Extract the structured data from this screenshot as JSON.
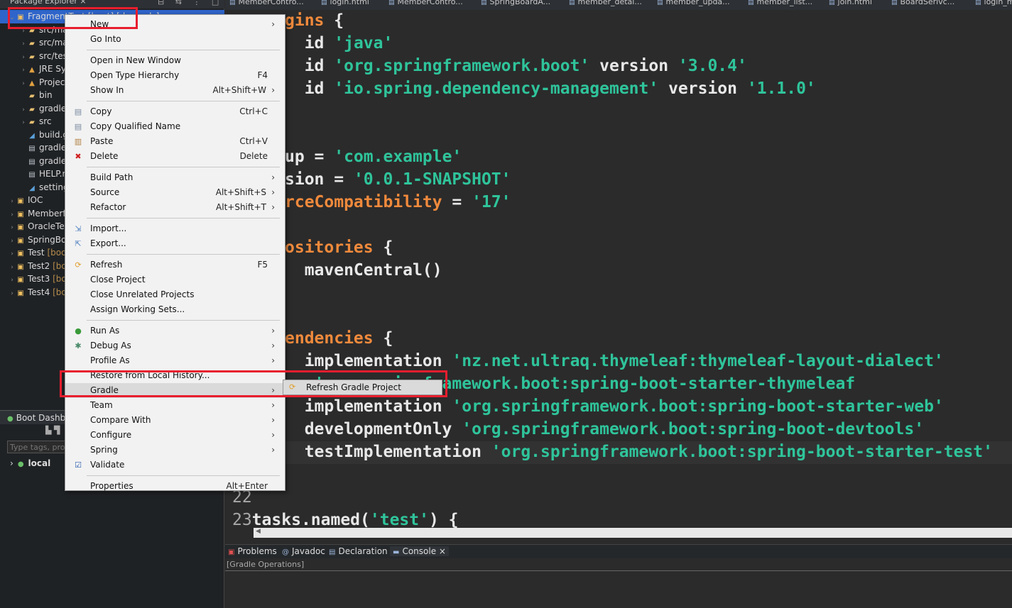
{
  "package_explorer": {
    "title": "Package Explorer ×",
    "toolbar": "⊟ ⇆ ⋮ □",
    "items": [
      {
        "twisty": "⌄",
        "icon": "▣",
        "icon_class": "ic-project",
        "label": "FragmentTest [boot] [devtools]",
        "dec": "",
        "indent": 0,
        "selected": true
      },
      {
        "twisty": "›",
        "icon": "▰",
        "icon_class": "ic-folder",
        "label": "src/ma",
        "dec": "",
        "indent": 1
      },
      {
        "twisty": "›",
        "icon": "▰",
        "icon_class": "ic-folder",
        "label": "src/ma",
        "dec": "",
        "indent": 1
      },
      {
        "twisty": "›",
        "icon": "▰",
        "icon_class": "ic-folder",
        "label": "src/tes",
        "dec": "",
        "indent": 1
      },
      {
        "twisty": "›",
        "icon": "▲",
        "icon_class": "ic-lib",
        "label": "JRE Sy",
        "dec": "",
        "indent": 1
      },
      {
        "twisty": "›",
        "icon": "▲",
        "icon_class": "ic-lib",
        "label": "Projec",
        "dec": "",
        "indent": 1
      },
      {
        "twisty": "",
        "icon": "▰",
        "icon_class": "ic-folder",
        "label": "bin",
        "dec": "",
        "indent": 1
      },
      {
        "twisty": "›",
        "icon": "▰",
        "icon_class": "ic-folder",
        "label": "gradle",
        "dec": "",
        "indent": 1
      },
      {
        "twisty": "›",
        "icon": "▰",
        "icon_class": "ic-folder",
        "label": "src",
        "dec": "",
        "indent": 1
      },
      {
        "twisty": "",
        "icon": "◢",
        "icon_class": "ic-gear",
        "label": "build.g",
        "dec": "",
        "indent": 1
      },
      {
        "twisty": "",
        "icon": "▤",
        "icon_class": "ic-file",
        "label": "gradle",
        "dec": "",
        "indent": 1
      },
      {
        "twisty": "",
        "icon": "▤",
        "icon_class": "ic-file",
        "label": "gradle",
        "dec": "",
        "indent": 1
      },
      {
        "twisty": "",
        "icon": "▤",
        "icon_class": "ic-file",
        "label": "HELP.r",
        "dec": "",
        "indent": 1
      },
      {
        "twisty": "",
        "icon": "◢",
        "icon_class": "ic-gear",
        "label": "setting",
        "dec": "",
        "indent": 1
      },
      {
        "twisty": "›",
        "icon": "▣",
        "icon_class": "ic-project",
        "label": "IOC",
        "dec": "",
        "indent": 0
      },
      {
        "twisty": "›",
        "icon": "▣",
        "icon_class": "ic-project",
        "label": "Memberf",
        "dec": "",
        "indent": 0
      },
      {
        "twisty": "›",
        "icon": "▣",
        "icon_class": "ic-project",
        "label": "OracleTe",
        "dec": "",
        "indent": 0
      },
      {
        "twisty": "›",
        "icon": "▣",
        "icon_class": "ic-project",
        "label": "SpringBo",
        "dec": "",
        "indent": 0
      },
      {
        "twisty": "›",
        "icon": "▣",
        "icon_class": "ic-project",
        "label": "Test ",
        "dec": "[boo",
        "indent": 0
      },
      {
        "twisty": "›",
        "icon": "▣",
        "icon_class": "ic-project",
        "label": "Test2 ",
        "dec": "[bo",
        "indent": 0
      },
      {
        "twisty": "›",
        "icon": "▣",
        "icon_class": "ic-project",
        "label": "Test3 ",
        "dec": "[bo",
        "indent": 0
      },
      {
        "twisty": "›",
        "icon": "▣",
        "icon_class": "ic-project",
        "label": "Test4 ",
        "dec": "[bo",
        "indent": 0
      }
    ]
  },
  "boot_dashboard": {
    "title": "Boot Dashb",
    "toolbar": "▙ ▜",
    "filter_placeholder": "Type tags, pro",
    "local_label": "local"
  },
  "editor_tabs": [
    {
      "label": "MemberContro..."
    },
    {
      "label": "login.html"
    },
    {
      "label": "MemberContro..."
    },
    {
      "label": "SpringBoardA..."
    },
    {
      "label": "member_detai..."
    },
    {
      "label": "member_upda..."
    },
    {
      "label": "member_list..."
    },
    {
      "label": "join.html"
    },
    {
      "label": "BoardSerivc..."
    },
    {
      "label": "login_m"
    }
  ],
  "code_lines": [
    {
      "num": "",
      "segments": [
        {
          "t": "gins {",
          "c": "kw-key",
          "partial": "gins",
          "rest": " {"
        }
      ]
    },
    {
      "num": "",
      "text_parts": [
        [
          "  id ",
          ""
        ],
        [
          "'java'",
          "kw-str"
        ]
      ]
    },
    {
      "num": "",
      "text_parts": [
        [
          "  id ",
          ""
        ],
        [
          "'org.springframework.boot'",
          "kw-str"
        ],
        [
          " version ",
          ""
        ],
        [
          "'3.0.4'",
          "kw-str"
        ]
      ]
    },
    {
      "num": "",
      "text_parts": [
        [
          "  id ",
          ""
        ],
        [
          "'io.spring.dependency-management'",
          "kw-str"
        ],
        [
          " version ",
          ""
        ],
        [
          "'1.1.0'",
          "kw-str"
        ]
      ]
    },
    {
      "num": "",
      "text_parts": [
        [
          "",
          ""
        ]
      ]
    },
    {
      "num": "",
      "text_parts": [
        [
          "",
          ""
        ]
      ]
    },
    {
      "num": "",
      "text_parts": [
        [
          "up = ",
          ""
        ],
        [
          "'com.example'",
          "kw-str"
        ]
      ]
    },
    {
      "num": "",
      "text_parts": [
        [
          "sion = ",
          ""
        ],
        [
          "'0.0.1-SNAPSHOT'",
          "kw-str"
        ]
      ]
    },
    {
      "num": "",
      "text_parts": [
        [
          "rceCompatibility",
          "kw-key"
        ],
        [
          " = ",
          ""
        ],
        [
          "'17'",
          "kw-str"
        ]
      ]
    },
    {
      "num": "",
      "text_parts": [
        [
          "",
          ""
        ]
      ]
    },
    {
      "num": "",
      "text_parts": [
        [
          "ositories",
          "kw-key"
        ],
        [
          " {",
          ""
        ]
      ]
    },
    {
      "num": "",
      "text_parts": [
        [
          "  mavenCentral()",
          ""
        ]
      ]
    },
    {
      "num": "",
      "text_parts": [
        [
          "",
          ""
        ]
      ]
    },
    {
      "num": "",
      "text_parts": [
        [
          "",
          ""
        ]
      ]
    },
    {
      "num": "",
      "text_parts": [
        [
          "endencies",
          "kw-key"
        ],
        [
          " {",
          ""
        ]
      ]
    },
    {
      "num": "",
      "text_parts": [
        [
          "  implementation ",
          ""
        ],
        [
          "'nz.net.ultraq.thymeleaf:thymeleaf-layout-dialect'",
          "kw-str"
        ]
      ]
    },
    {
      "num": "",
      "text_parts": [
        [
          "on ",
          ""
        ],
        [
          "'org.springframework.boot:spring-boot-starter-thymeleaf",
          "kw-str"
        ]
      ]
    },
    {
      "num": "",
      "text_parts": [
        [
          "  implementation ",
          ""
        ],
        [
          "'org.springframework.boot:spring-boot-starter-web'",
          "kw-str"
        ]
      ]
    },
    {
      "num": "",
      "text_parts": [
        [
          "  developmentOnly ",
          ""
        ],
        [
          "'org.springframework.boot:spring-boot-devtools'",
          "kw-str"
        ]
      ]
    },
    {
      "num": "",
      "text_parts": [
        [
          "  testImplementation ",
          ""
        ],
        [
          "'org.springframework.boot:spring-boot-starter-test'",
          "kw-str"
        ]
      ]
    },
    {
      "num": "",
      "text_parts": [
        [
          "",
          ""
        ]
      ]
    },
    {
      "num": "22",
      "text_parts": [
        [
          "",
          ""
        ]
      ]
    },
    {
      "num": "23",
      "text_parts": [
        [
          "tasks.named(",
          ""
        ],
        [
          "'test'",
          "kw-str"
        ],
        [
          ") {",
          ""
        ]
      ]
    }
  ],
  "bottom_tabs": [
    {
      "label": "Problems",
      "icon": "▣",
      "color": "#e05050"
    },
    {
      "label": "Javadoc",
      "icon": "@",
      "color": "#9bb4d8"
    },
    {
      "label": "Declaration",
      "icon": "▤",
      "color": "#9bb4d8"
    },
    {
      "label": "Console ×",
      "icon": "▬",
      "color": "#9bb4d8"
    }
  ],
  "console_label": "[Gradle Operations]",
  "context_menu": {
    "items": [
      {
        "label": "New",
        "shortcut": "",
        "arrow": true,
        "icon": "",
        "icon_color": ""
      },
      {
        "label": "Go Into",
        "shortcut": "",
        "arrow": false,
        "icon": "",
        "icon_color": ""
      },
      {
        "sep": true
      },
      {
        "label": "Open in New Window",
        "shortcut": "",
        "arrow": false,
        "icon": "",
        "icon_color": ""
      },
      {
        "label": "Open Type Hierarchy",
        "shortcut": "F4",
        "arrow": false,
        "icon": "",
        "icon_color": ""
      },
      {
        "label": "Show In",
        "shortcut": "Alt+Shift+W",
        "arrow": true,
        "icon": "",
        "icon_color": ""
      },
      {
        "sep": true
      },
      {
        "label": "Copy",
        "shortcut": "Ctrl+C",
        "arrow": false,
        "icon": "▤",
        "icon_color": "#7a8aa0"
      },
      {
        "label": "Copy Qualified Name",
        "shortcut": "",
        "arrow": false,
        "icon": "▤",
        "icon_color": "#7a8aa0"
      },
      {
        "label": "Paste",
        "shortcut": "Ctrl+V",
        "arrow": false,
        "icon": "▥",
        "icon_color": "#b08040"
      },
      {
        "label": "Delete",
        "shortcut": "Delete",
        "arrow": false,
        "icon": "✖",
        "icon_color": "#d02020"
      },
      {
        "sep": true
      },
      {
        "label": "Build Path",
        "shortcut": "",
        "arrow": true,
        "icon": "",
        "icon_color": ""
      },
      {
        "label": "Source",
        "shortcut": "Alt+Shift+S",
        "arrow": true,
        "icon": "",
        "icon_color": ""
      },
      {
        "label": "Refactor",
        "shortcut": "Alt+Shift+T",
        "arrow": true,
        "icon": "",
        "icon_color": ""
      },
      {
        "sep": true
      },
      {
        "label": "Import...",
        "shortcut": "",
        "arrow": false,
        "icon": "⇲",
        "icon_color": "#5080c0"
      },
      {
        "label": "Export...",
        "shortcut": "",
        "arrow": false,
        "icon": "⇱",
        "icon_color": "#5080c0"
      },
      {
        "sep": true
      },
      {
        "label": "Refresh",
        "shortcut": "F5",
        "arrow": false,
        "icon": "⟳",
        "icon_color": "#e0a030"
      },
      {
        "label": "Close Project",
        "shortcut": "",
        "arrow": false,
        "icon": "",
        "icon_color": ""
      },
      {
        "label": "Close Unrelated Projects",
        "shortcut": "",
        "arrow": false,
        "icon": "",
        "icon_color": ""
      },
      {
        "label": "Assign Working Sets...",
        "shortcut": "",
        "arrow": false,
        "icon": "",
        "icon_color": ""
      },
      {
        "sep": true
      },
      {
        "label": "Run As",
        "shortcut": "",
        "arrow": true,
        "icon": "●",
        "icon_color": "#3a9a3a"
      },
      {
        "label": "Debug As",
        "shortcut": "",
        "arrow": true,
        "icon": "✱",
        "icon_color": "#4a8a6a"
      },
      {
        "label": "Profile As",
        "shortcut": "",
        "arrow": true,
        "icon": "",
        "icon_color": ""
      },
      {
        "label": "Restore from Local History...",
        "shortcut": "",
        "arrow": false,
        "icon": "",
        "icon_color": ""
      },
      {
        "label": "Gradle",
        "shortcut": "",
        "arrow": true,
        "icon": "",
        "icon_color": "",
        "highlight": true
      },
      {
        "label": "Team",
        "shortcut": "",
        "arrow": true,
        "icon": "",
        "icon_color": ""
      },
      {
        "label": "Compare With",
        "shortcut": "",
        "arrow": true,
        "icon": "",
        "icon_color": ""
      },
      {
        "label": "Configure",
        "shortcut": "",
        "arrow": true,
        "icon": "",
        "icon_color": ""
      },
      {
        "label": "Spring",
        "shortcut": "",
        "arrow": true,
        "icon": "",
        "icon_color": ""
      },
      {
        "label": "Validate",
        "shortcut": "",
        "arrow": false,
        "icon": "☑",
        "icon_color": "#3060b0"
      },
      {
        "sep": true
      },
      {
        "label": "Properties",
        "shortcut": "Alt+Enter",
        "arrow": false,
        "icon": "",
        "icon_color": ""
      }
    ]
  },
  "sub_menu": {
    "label": "Refresh Gradle Project"
  },
  "colors": {
    "highlight_red": "#e81e2e",
    "selection_blue": "#2f65ca",
    "string_green": "#2fc49b",
    "keyword_orange": "#f08a3c"
  }
}
